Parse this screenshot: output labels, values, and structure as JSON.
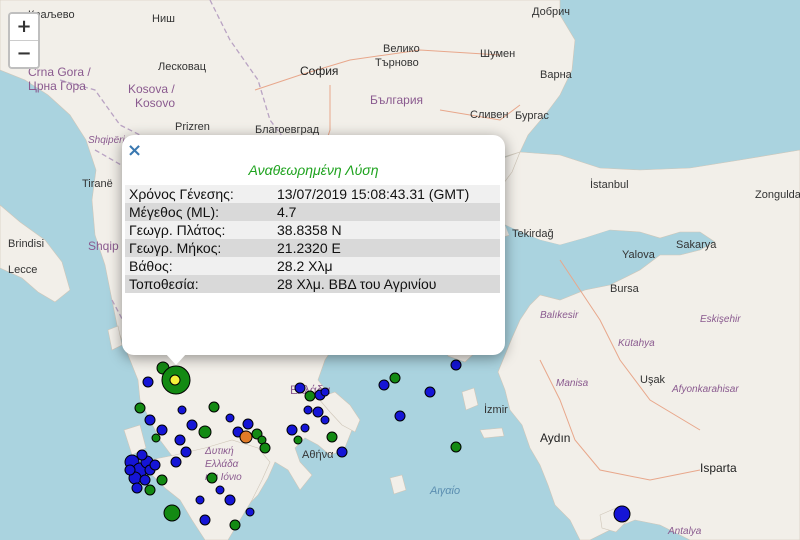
{
  "zoom": {
    "in_label": "+",
    "out_label": "−"
  },
  "map_labels": {
    "kraljevo": "Краљево",
    "nis": "Ниш",
    "leskovac": "Лесковац",
    "crna_gora_1": "Crna Gora /",
    "crna_gora_2": "Црна Гора",
    "kosova_1": "Kosova /",
    "kosova_2": "Kosovo",
    "prizren": "Prizren",
    "sofia": "София",
    "bulgaria": "България",
    "blagoevgrad": "Благоевград",
    "veliko_1": "Велико",
    "veliko_2": "Търново",
    "shumen": "Шумен",
    "dobrich": "Добрич",
    "varna": "Варна",
    "burgas": "Бургас",
    "sliven": "Сливен",
    "shqiperia": "Shqipëria",
    "shqip": "Shqip",
    "tirane": "Tiranë",
    "brindisi": "Brindisi",
    "lecce": "Lecce",
    "istanbul": "İstanbul",
    "tekirdag": "Tekirdağ",
    "yalova": "Yalova",
    "sakarya": "Sakarya",
    "zonguldak": "Zongulda",
    "bursa": "Bursa",
    "balikesir": "Balıkesir",
    "eskisehir": "Eskişehir",
    "kutahya": "Kütahya",
    "manisa": "Manisa",
    "usak": "Uşak",
    "afyon": "Afyonkarahisar",
    "izmir": "İzmir",
    "aydin": "Aydın",
    "isparta": "Isparta",
    "antalya": "Antalya",
    "ellada": "Ελλάδα",
    "athina": "Αθήνα",
    "dytiki_1": "Δυτική",
    "dytiki_2": "Ελλάδα",
    "dytiki_3": "και Ιόνιο",
    "aigaio": "Αιγαίο"
  },
  "popup": {
    "close_label": "×",
    "title": "Αναθεωρημένη Λύση",
    "rows": [
      {
        "key": "Χρόνος Γένεσης:",
        "value": "13/07/2019 15:08:43.31 (GMT)"
      },
      {
        "key": "Μέγεθος (ML):",
        "value": "4.7"
      },
      {
        "key": "Γεωγρ. Πλάτος:",
        "value": "38.8358 N"
      },
      {
        "key": "Γεωγρ. Μήκος:",
        "value": "21.2320 E"
      },
      {
        "key": "Βάθος:",
        "value": "28.2 Χλμ"
      },
      {
        "key": "Τοποθεσία:",
        "value": "28 Χλμ. ΒΒΔ του Αγρινίου"
      }
    ]
  },
  "colors": {
    "sea": "#aad3df",
    "land": "#f2efe9",
    "event_blue": "#1515d6",
    "event_green": "#138a13",
    "event_orange": "#e07b28",
    "event_selected": "#f4f23a",
    "popup_title": "#1fa31f"
  }
}
